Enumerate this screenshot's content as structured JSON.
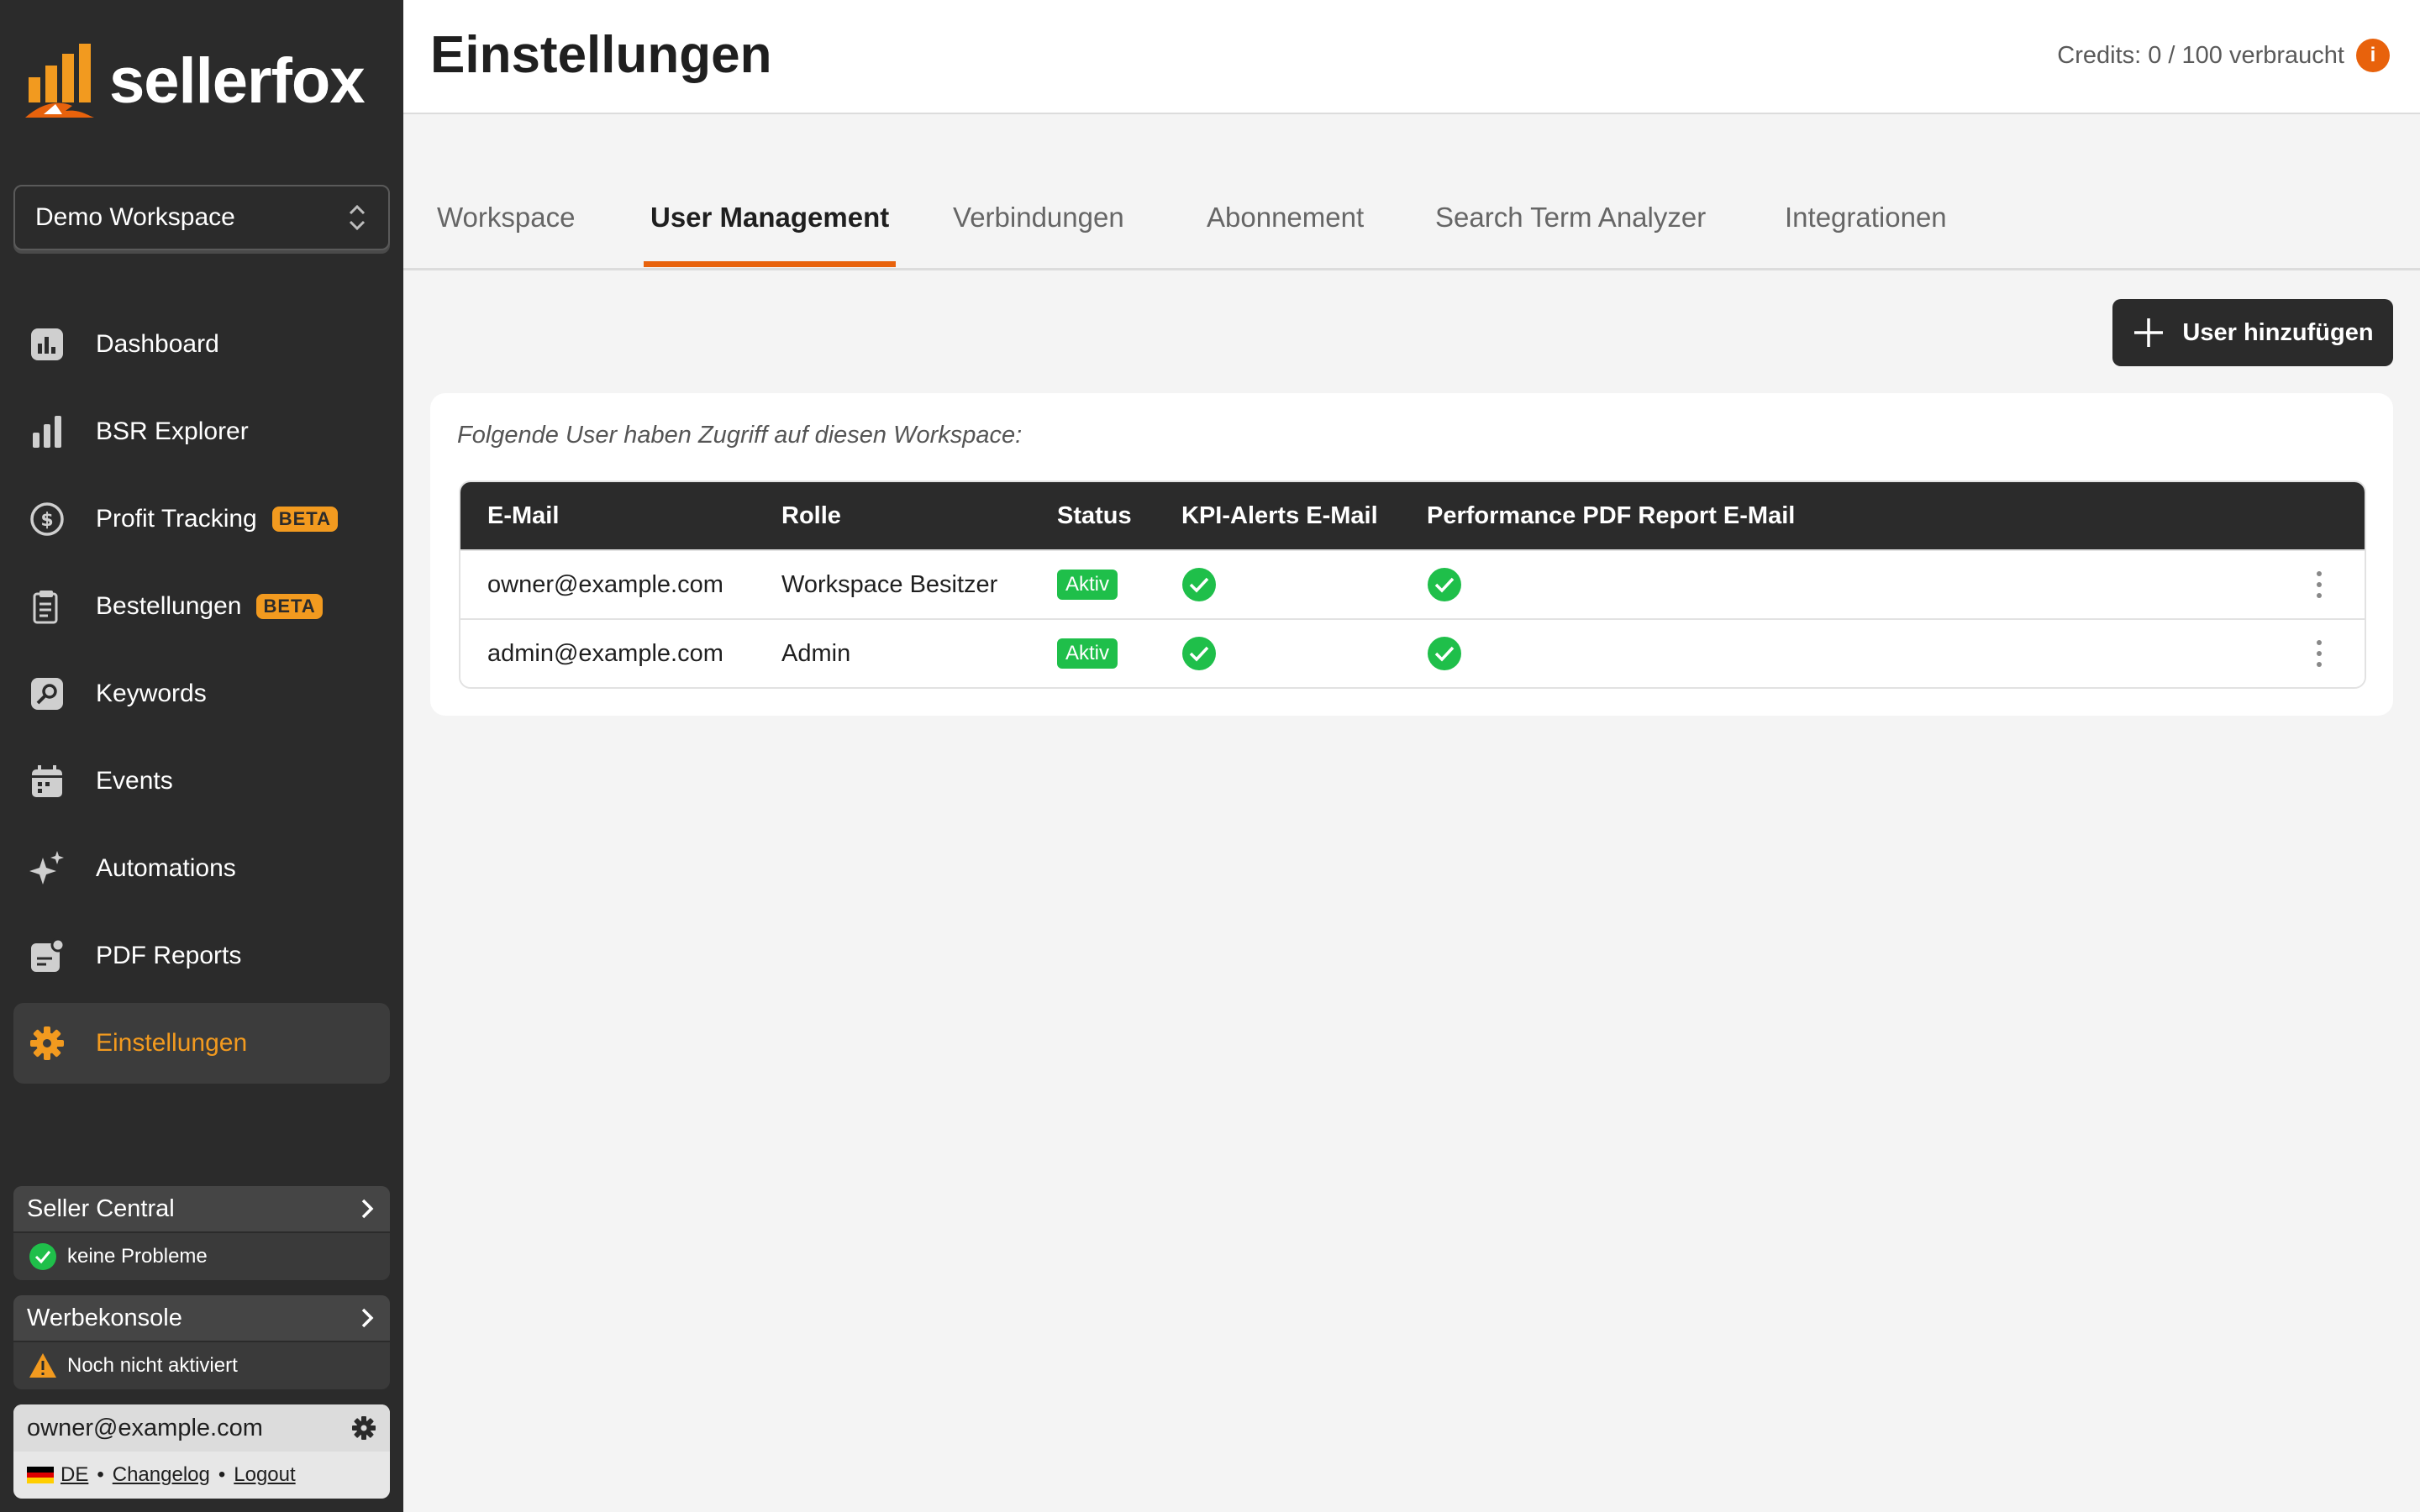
{
  "app": {
    "brand": "sellerfox",
    "colors": {
      "accent": "#e8620c",
      "brand_orange": "#f29a1f",
      "sidebar": "#2b2b2b",
      "success": "#1fbf4a"
    }
  },
  "sidebar": {
    "workspace_selector": "Demo Workspace",
    "nav": [
      {
        "label": "Dashboard",
        "icon": "dashboard-icon"
      },
      {
        "label": "BSR Explorer",
        "icon": "bar-chart-icon"
      },
      {
        "label": "Profit Tracking",
        "icon": "dollar-icon",
        "badge": "BETA"
      },
      {
        "label": "Bestellungen",
        "icon": "clipboard-icon",
        "badge": "BETA"
      },
      {
        "label": "Keywords",
        "icon": "key-icon"
      },
      {
        "label": "Events",
        "icon": "calendar-icon"
      },
      {
        "label": "Automations",
        "icon": "sparkle-icon"
      },
      {
        "label": "PDF Reports",
        "icon": "report-icon"
      },
      {
        "label": "Einstellungen",
        "icon": "gear-icon",
        "active": true
      }
    ],
    "seller_central": {
      "title": "Seller Central",
      "status": "keine Probleme"
    },
    "werbekonsole": {
      "title": "Werbekonsole",
      "status": "Noch nicht aktiviert"
    },
    "user": {
      "email": "owner@example.com",
      "language": "DE",
      "changelog": "Changelog",
      "logout": "Logout",
      "separator": "•"
    }
  },
  "header": {
    "title": "Einstellungen",
    "credits": "Credits: 0 / 100 verbraucht",
    "info": "i"
  },
  "tabs": [
    {
      "label": "Workspace"
    },
    {
      "label": "User Management",
      "active": true
    },
    {
      "label": "Verbindungen"
    },
    {
      "label": "Abonnement"
    },
    {
      "label": "Search Term Analyzer"
    },
    {
      "label": "Integrationen"
    }
  ],
  "main": {
    "add_user_label": "User hinzufügen",
    "intro": "Folgende User haben Zugriff auf diesen Workspace:",
    "table": {
      "columns": [
        "E-Mail",
        "Rolle",
        "Status",
        "KPI-Alerts E-Mail",
        "Performance PDF Report E-Mail"
      ],
      "rows": [
        {
          "email": "owner@example.com",
          "role": "Workspace Besitzer",
          "status": "Aktiv",
          "kpi": true,
          "pdf": true
        },
        {
          "email": "admin@example.com",
          "role": "Admin",
          "status": "Aktiv",
          "kpi": true,
          "pdf": true
        }
      ]
    }
  }
}
